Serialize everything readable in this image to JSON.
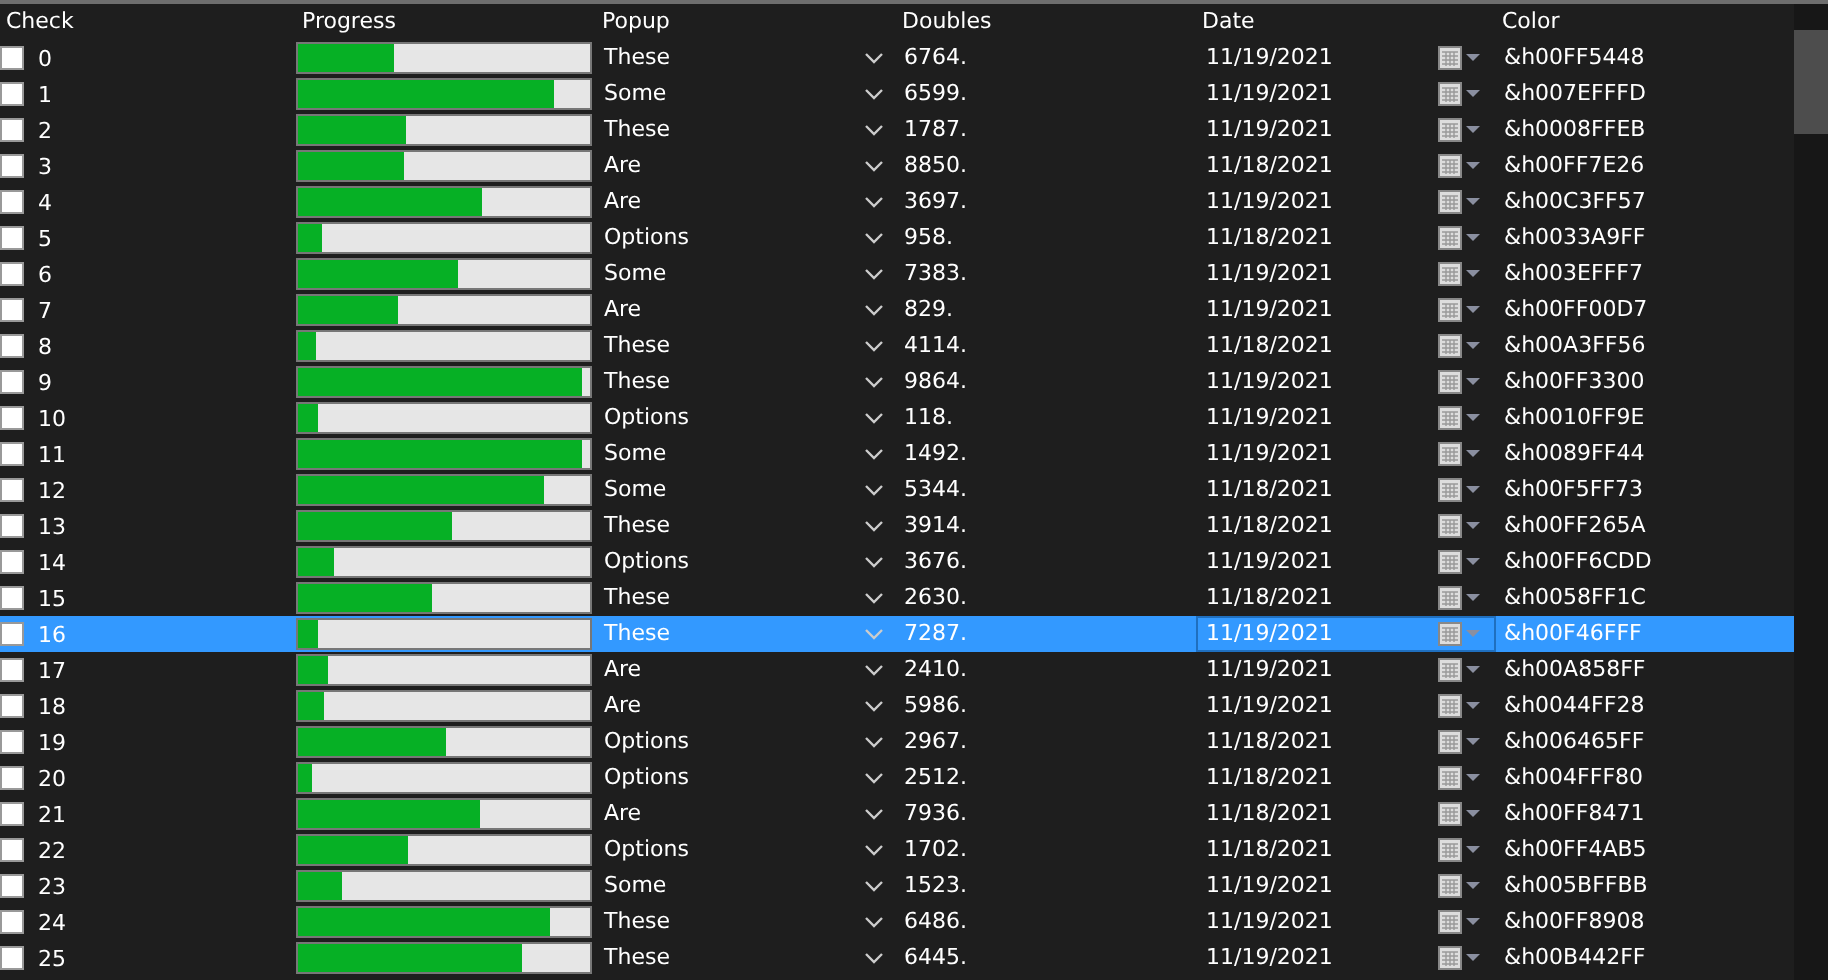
{
  "columns": [
    "Check",
    "Progress",
    "Popup",
    "Doubles",
    "Date",
    "Color"
  ],
  "rows": [
    {
      "checked": false,
      "selected": false,
      "id": "0",
      "level": 0.33,
      "popup": "These",
      "double": "6764.",
      "date": "11/19/2021",
      "color_code": "&h00FF5448"
    },
    {
      "checked": false,
      "selected": false,
      "id": "1",
      "level": 0.88,
      "popup": "Some",
      "double": "6599.",
      "date": "11/19/2021",
      "color_code": "&h007EFFFD"
    },
    {
      "checked": false,
      "selected": false,
      "id": "2",
      "level": 0.37,
      "popup": "These",
      "double": "1787.",
      "date": "11/19/2021",
      "color_code": "&h0008FFEB"
    },
    {
      "checked": false,
      "selected": false,
      "id": "3",
      "level": 0.36,
      "popup": "Are",
      "double": "8850.",
      "date": "11/18/2021",
      "color_code": "&h00FF7E26"
    },
    {
      "checked": false,
      "selected": false,
      "id": "4",
      "level": 0.63,
      "popup": "Are",
      "double": "3697.",
      "date": "11/19/2021",
      "color_code": "&h00C3FF57"
    },
    {
      "checked": false,
      "selected": false,
      "id": "5",
      "level": 0.08,
      "popup": "Options",
      "double": "958.",
      "date": "11/18/2021",
      "color_code": "&h0033A9FF"
    },
    {
      "checked": false,
      "selected": false,
      "id": "6",
      "level": 0.55,
      "popup": "Some",
      "double": "7383.",
      "date": "11/19/2021",
      "color_code": "&h003EFFF7"
    },
    {
      "checked": false,
      "selected": false,
      "id": "7",
      "level": 0.34,
      "popup": "Are",
      "double": "829.",
      "date": "11/19/2021",
      "color_code": "&h00FF00D7"
    },
    {
      "checked": false,
      "selected": false,
      "id": "8",
      "level": 0.06,
      "popup": "These",
      "double": "4114.",
      "date": "11/18/2021",
      "color_code": "&h00A3FF56"
    },
    {
      "checked": false,
      "selected": false,
      "id": "9",
      "level": 0.97,
      "popup": "These",
      "double": "9864.",
      "date": "11/19/2021",
      "color_code": "&h00FF3300"
    },
    {
      "checked": false,
      "selected": false,
      "id": "10",
      "level": 0.07,
      "popup": "Options",
      "double": "118.",
      "date": "11/19/2021",
      "color_code": "&h0010FF9E"
    },
    {
      "checked": false,
      "selected": false,
      "id": "11",
      "level": 0.97,
      "popup": "Some",
      "double": "1492.",
      "date": "11/19/2021",
      "color_code": "&h0089FF44"
    },
    {
      "checked": false,
      "selected": false,
      "id": "12",
      "level": 0.84,
      "popup": "Some",
      "double": "5344.",
      "date": "11/18/2021",
      "color_code": "&h00F5FF73"
    },
    {
      "checked": false,
      "selected": false,
      "id": "13",
      "level": 0.53,
      "popup": "These",
      "double": "3914.",
      "date": "11/18/2021",
      "color_code": "&h00FF265A"
    },
    {
      "checked": false,
      "selected": false,
      "id": "14",
      "level": 0.12,
      "popup": "Options",
      "double": "3676.",
      "date": "11/19/2021",
      "color_code": "&h00FF6CDD"
    },
    {
      "checked": false,
      "selected": false,
      "id": "15",
      "level": 0.46,
      "popup": "These",
      "double": "2630.",
      "date": "11/18/2021",
      "color_code": "&h0058FF1C"
    },
    {
      "checked": false,
      "selected": true,
      "id": "16",
      "level": 0.07,
      "popup": "These",
      "double": "7287.",
      "date": "11/19/2021",
      "color_code": "&h00F46FFF"
    },
    {
      "checked": false,
      "selected": false,
      "id": "17",
      "level": 0.1,
      "popup": "Are",
      "double": "2410.",
      "date": "11/19/2021",
      "color_code": "&h00A858FF"
    },
    {
      "checked": false,
      "selected": false,
      "id": "18",
      "level": 0.09,
      "popup": "Are",
      "double": "5986.",
      "date": "11/19/2021",
      "color_code": "&h0044FF28"
    },
    {
      "checked": false,
      "selected": false,
      "id": "19",
      "level": 0.51,
      "popup": "Options",
      "double": "2967.",
      "date": "11/18/2021",
      "color_code": "&h006465FF"
    },
    {
      "checked": false,
      "selected": false,
      "id": "20",
      "level": 0.05,
      "popup": "Options",
      "double": "2512.",
      "date": "11/18/2021",
      "color_code": "&h004FFF80"
    },
    {
      "checked": false,
      "selected": false,
      "id": "21",
      "level": 0.62,
      "popup": "Are",
      "double": "7936.",
      "date": "11/18/2021",
      "color_code": "&h00FF8471"
    },
    {
      "checked": false,
      "selected": false,
      "id": "22",
      "level": 0.38,
      "popup": "Options",
      "double": "1702.",
      "date": "11/18/2021",
      "color_code": "&h00FF4AB5"
    },
    {
      "checked": false,
      "selected": false,
      "id": "23",
      "level": 0.15,
      "popup": "Some",
      "double": "1523.",
      "date": "11/19/2021",
      "color_code": "&h005BFFBB"
    },
    {
      "checked": false,
      "selected": false,
      "id": "24",
      "level": 0.86,
      "popup": "These",
      "double": "6486.",
      "date": "11/19/2021",
      "color_code": "&h00FF8908"
    },
    {
      "checked": false,
      "selected": false,
      "id": "25",
      "level": 0.77,
      "popup": "These",
      "double": "6445.",
      "date": "11/19/2021",
      "color_code": "&h00B442FF"
    }
  ]
}
